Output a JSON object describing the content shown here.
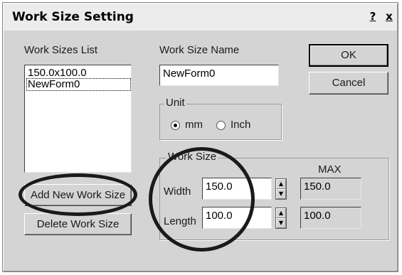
{
  "dialog": {
    "title": "Work Size Setting",
    "help_button": "?",
    "close_button": "x"
  },
  "work_sizes_list": {
    "label": "Work Sizes List",
    "items": [
      "150.0x100.0",
      "NewForm0"
    ]
  },
  "work_size_name": {
    "label": "Work Size Name",
    "value": "NewForm0"
  },
  "buttons": {
    "ok": "OK",
    "cancel": "Cancel",
    "add_new": "Add New Work Size",
    "delete": "Delete Work Size"
  },
  "unit": {
    "label": "Unit",
    "options": [
      "mm",
      "Inch"
    ],
    "selected": "mm"
  },
  "work_size": {
    "label": "Work Size",
    "max_label": "MAX",
    "width_label": "Width",
    "width_value": "150.0",
    "width_max": "150.0",
    "length_label": "Length",
    "length_value": "100.0",
    "length_max": "100.0"
  },
  "icons": {
    "spinner_up": "spin-up-arrow",
    "spinner_down": "spin-down-arrow",
    "highlight": "circle-annotation"
  }
}
